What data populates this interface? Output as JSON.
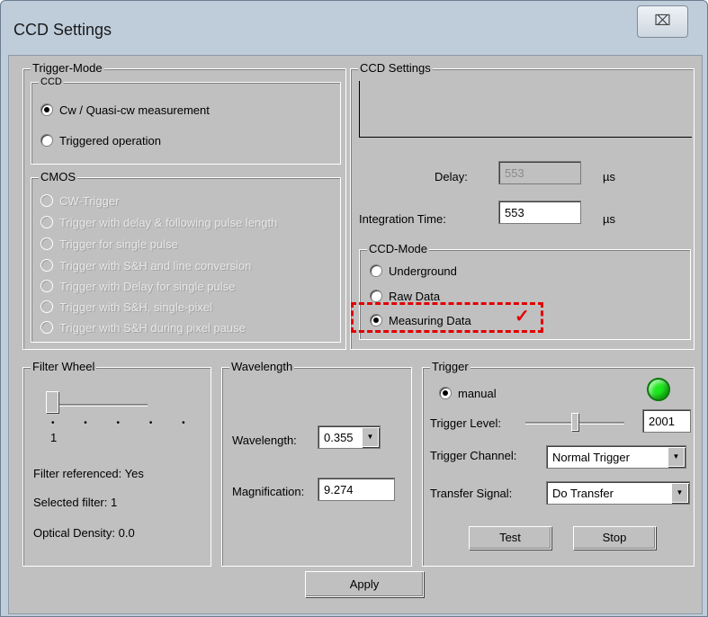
{
  "window": {
    "title": "CCD Settings",
    "close_glyph": "⌧"
  },
  "trigger_mode": {
    "label": "Trigger-Mode",
    "ccd": {
      "label": "CCD",
      "options": [
        "Cw / Quasi-cw measurement",
        "Triggered operation"
      ],
      "selected": 0
    },
    "cmos": {
      "label": "CMOS",
      "options": [
        "CW-Trigger",
        "Trigger with delay & following pulse length",
        "Trigger for single pulse",
        "Trigger with S&H and line conversion",
        "Trigger with Delay for single pulse",
        "Trigger with S&H, single-pixel",
        "Trigger with S&H during pixel pause"
      ]
    }
  },
  "ccd_settings": {
    "label": "CCD Settings",
    "delay_label": "Delay:",
    "delay_value": "553",
    "delay_unit": "µs",
    "integration_label": "Integration Time:",
    "integration_value": "553",
    "integration_unit": "µs",
    "ccd_mode": {
      "label": "CCD-Mode",
      "options": [
        "Underground",
        "Raw Data",
        "Measuring Data"
      ],
      "selected": 2,
      "checkmark": "✓"
    }
  },
  "filter_wheel": {
    "label": "Filter Wheel",
    "slider_value": "1",
    "referenced": "Filter referenced: Yes",
    "selected_filter": "Selected filter: 1",
    "optical_density": "Optical Density:  0.0"
  },
  "wavelength": {
    "label": "Wavelength",
    "wavelength_label": "Wavelength:",
    "wavelength_value": "0.355",
    "magnification_label": "Magnification:",
    "magnification_value": "9.274"
  },
  "trigger": {
    "label": "Trigger",
    "manual_label": "manual",
    "indicator_color": "#1ee81e",
    "level_label": "Trigger Level:",
    "level_value": "2001",
    "channel_label": "Trigger Channel:",
    "channel_value": "Normal Trigger",
    "transfer_label": "Transfer Signal:",
    "transfer_value": "Do Transfer",
    "test_button": "Test",
    "stop_button": "Stop"
  },
  "apply_button": "Apply",
  "highlight_color": "#e00000"
}
